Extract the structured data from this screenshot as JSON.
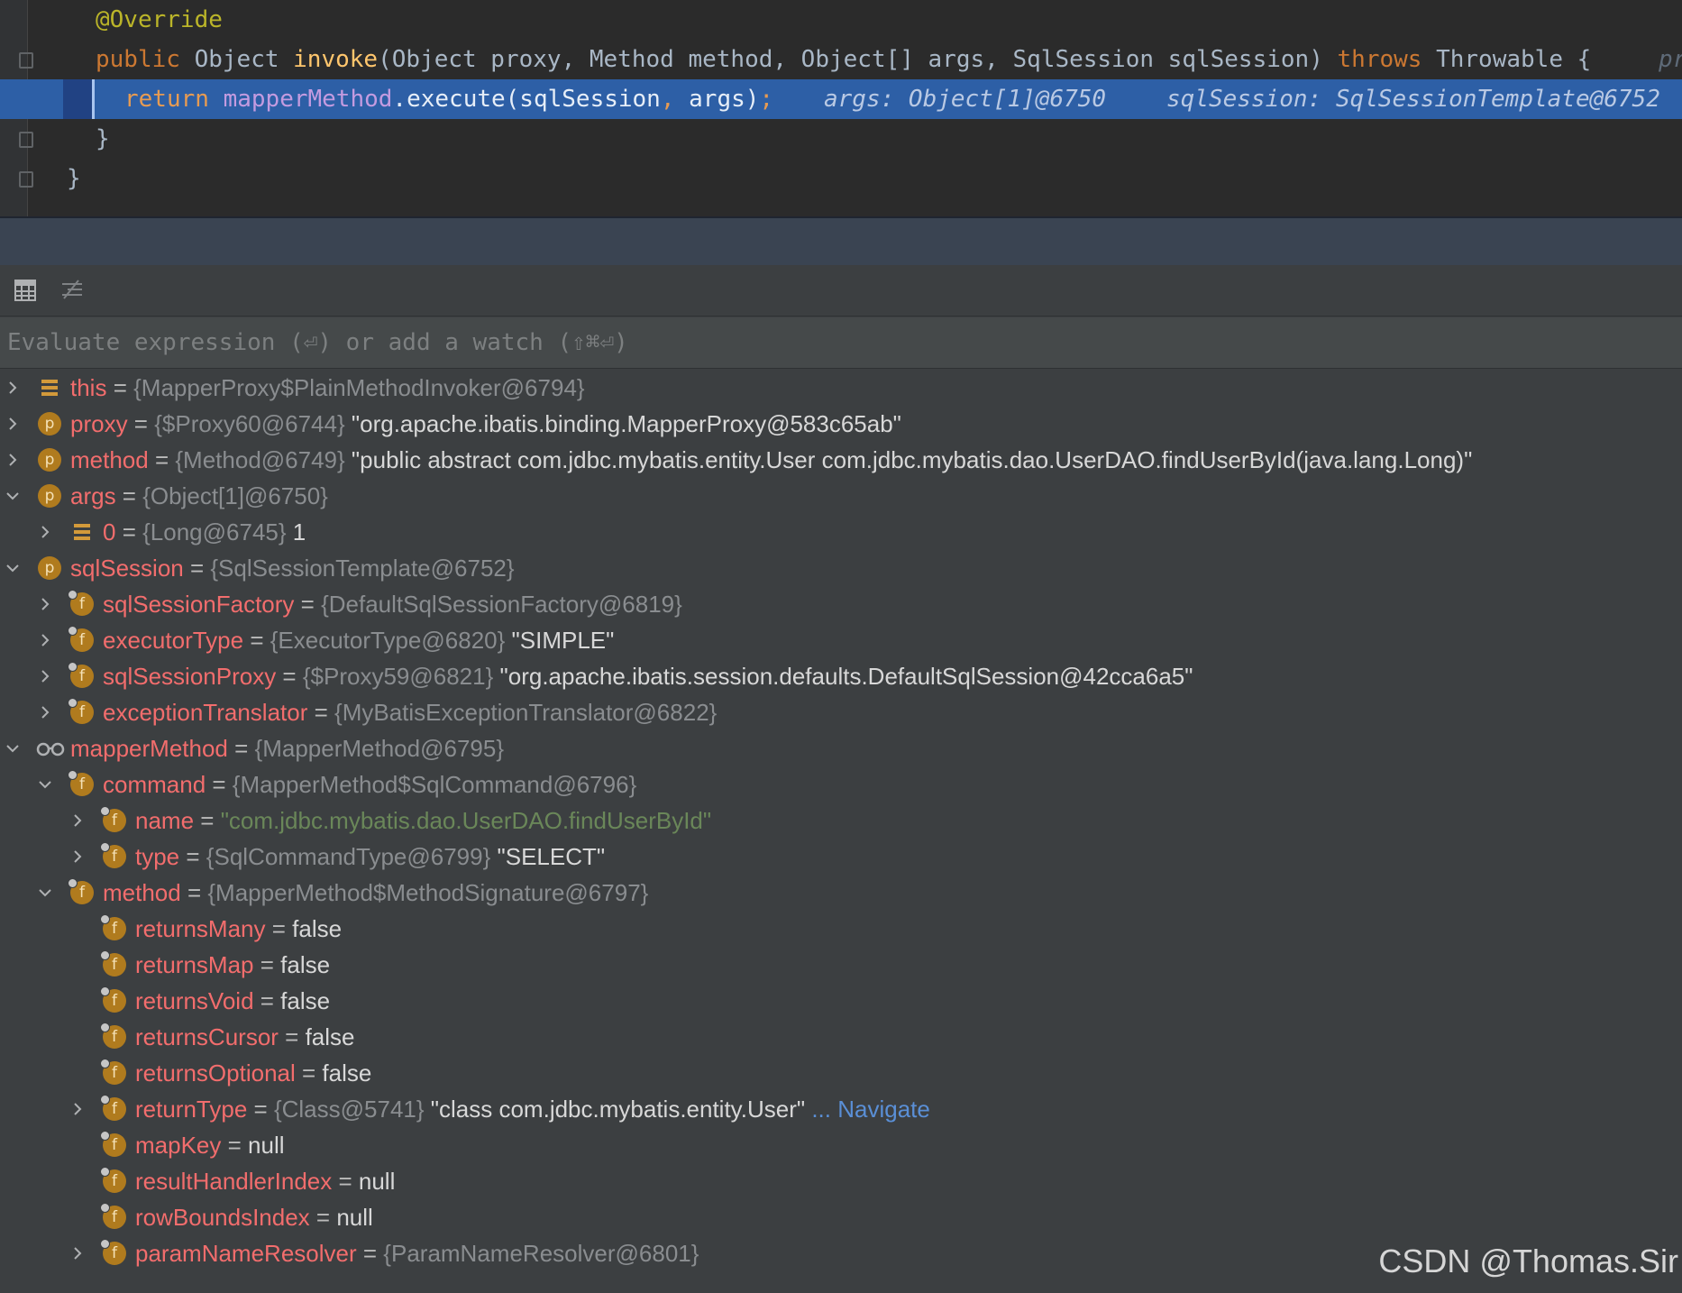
{
  "editor": {
    "line1": "@Override",
    "line2": {
      "kw_public": "public",
      "t1": " Object ",
      "method": "invoke",
      "params": "(Object proxy, Method method, Object[] args, SqlSession sqlSession) ",
      "kw_throws": "throws",
      "t2": " Throwable {",
      "faded_hint": "pr"
    },
    "line3": {
      "kw_return": "return",
      "field": "mapperMethod",
      "call": ".execute(sqlSession",
      "comma": ",",
      "args": " args)",
      "semi": ";",
      "hint1": "args: Object[1]@6750",
      "hint2": "sqlSession: SqlSessionTemplate@6752"
    },
    "line4": "}",
    "line5": "}"
  },
  "toolbar": {
    "table_icon": "table-view-icon",
    "list_icon": "flatten-list-icon"
  },
  "eval": {
    "placeholder": "Evaluate expression (⏎) or add a watch (⇧⌘⏎)"
  },
  "icons": {
    "chevron_right": "›",
    "chevron_down": "⌄",
    "p_badge": "p",
    "f_badge": "f"
  },
  "variables": [
    {
      "name": "this",
      "eq": " = ",
      "type": "{MapperProxy$PlainMethodInvoker@6794}",
      "value": "",
      "str": ""
    },
    {
      "name": "proxy",
      "eq": " = ",
      "type": "{$Proxy60@6744}",
      "value": " \"org.apache.ibatis.binding.MapperProxy@583c65ab\"",
      "str": ""
    },
    {
      "name": "method",
      "eq": " = ",
      "type": "{Method@6749}",
      "value": " \"public abstract com.jdbc.mybatis.entity.User com.jdbc.mybatis.dao.UserDAO.findUserById(java.lang.Long)\"",
      "str": ""
    },
    {
      "name": "args",
      "eq": " = ",
      "type": "{Object[1]@6750}",
      "value": "",
      "str": ""
    },
    {
      "name": "0",
      "eq": " = ",
      "type": "{Long@6745}",
      "value": " 1",
      "str": ""
    },
    {
      "name": "sqlSession",
      "eq": " = ",
      "type": "{SqlSessionTemplate@6752}",
      "value": "",
      "str": ""
    },
    {
      "name": "sqlSessionFactory",
      "eq": " = ",
      "type": "{DefaultSqlSessionFactory@6819}",
      "value": "",
      "str": ""
    },
    {
      "name": "executorType",
      "eq": " = ",
      "type": "{ExecutorType@6820}",
      "value": " \"SIMPLE\"",
      "str": ""
    },
    {
      "name": "sqlSessionProxy",
      "eq": " = ",
      "type": "{$Proxy59@6821}",
      "value": " \"org.apache.ibatis.session.defaults.DefaultSqlSession@42cca6a5\"",
      "str": ""
    },
    {
      "name": "exceptionTranslator",
      "eq": " = ",
      "type": "{MyBatisExceptionTranslator@6822}",
      "value": "",
      "str": ""
    },
    {
      "name": "mapperMethod",
      "eq": " = ",
      "type": "{MapperMethod@6795}",
      "value": "",
      "str": ""
    },
    {
      "name": "command",
      "eq": " = ",
      "type": "{MapperMethod$SqlCommand@6796}",
      "value": "",
      "str": ""
    },
    {
      "name": "name",
      "eq": " = ",
      "type": "",
      "value": "",
      "str": "\"com.jdbc.mybatis.dao.UserDAO.findUserById\""
    },
    {
      "name": "type",
      "eq": " = ",
      "type": "{SqlCommandType@6799}",
      "value": " \"SELECT\"",
      "str": ""
    },
    {
      "name": "method",
      "eq": " = ",
      "type": "{MapperMethod$MethodSignature@6797}",
      "value": "",
      "str": ""
    },
    {
      "name": "returnsMany",
      "eq": " = ",
      "type": "",
      "value": "false",
      "str": ""
    },
    {
      "name": "returnsMap",
      "eq": " = ",
      "type": "",
      "value": "false",
      "str": ""
    },
    {
      "name": "returnsVoid",
      "eq": " = ",
      "type": "",
      "value": "false",
      "str": ""
    },
    {
      "name": "returnsCursor",
      "eq": " = ",
      "type": "",
      "value": "false",
      "str": ""
    },
    {
      "name": "returnsOptional",
      "eq": " = ",
      "type": "",
      "value": "false",
      "str": ""
    },
    {
      "name": "returnType",
      "eq": " = ",
      "type": "{Class@5741}",
      "value": " \"class com.jdbc.mybatis.entity.User\"",
      "str": "",
      "link": " ... Navigate"
    },
    {
      "name": "mapKey",
      "eq": " = ",
      "type": "",
      "value": "null",
      "str": ""
    },
    {
      "name": "resultHandlerIndex",
      "eq": " = ",
      "type": "",
      "value": "null",
      "str": ""
    },
    {
      "name": "rowBoundsIndex",
      "eq": " = ",
      "type": "",
      "value": "null",
      "str": ""
    },
    {
      "name": "paramNameResolver",
      "eq": " = ",
      "type": "{ParamNameResolver@6801}",
      "value": "",
      "str": ""
    }
  ],
  "watermark": "CSDN @Thomas.Sir"
}
